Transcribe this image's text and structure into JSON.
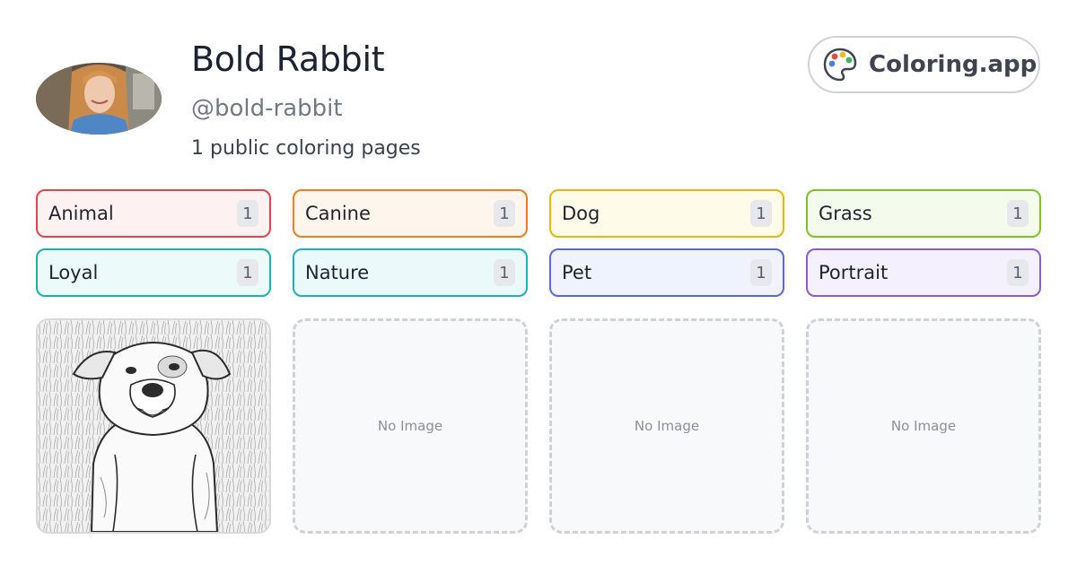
{
  "profile": {
    "name": "Bold Rabbit",
    "handle": "@bold-rabbit",
    "count_text": "1 public coloring pages"
  },
  "brand": {
    "label": "Coloring.app",
    "icon": "palette-icon"
  },
  "tags": [
    {
      "label": "Animal",
      "count": "1",
      "border": "#e0474c",
      "bg": "#fef1f1"
    },
    {
      "label": "Canine",
      "count": "1",
      "border": "#ef7d24",
      "bg": "#fef5ec"
    },
    {
      "label": "Dog",
      "count": "1",
      "border": "#e8b60c",
      "bg": "#fefbe8"
    },
    {
      "label": "Grass",
      "count": "1",
      "border": "#7ac623",
      "bg": "#f4fbec"
    },
    {
      "label": "Loyal",
      "count": "1",
      "border": "#19b3a8",
      "bg": "#ecfbf9"
    },
    {
      "label": "Nature",
      "count": "1",
      "border": "#19b0c8",
      "bg": "#ecf9fb"
    },
    {
      "label": "Pet",
      "count": "1",
      "border": "#5a68dd",
      "bg": "#f0f2fd"
    },
    {
      "label": "Portrait",
      "count": "1",
      "border": "#8b5bd8",
      "bg": "#f5f0fd"
    }
  ],
  "cards": [
    {
      "type": "image",
      "subject": "dog-coloring-page"
    },
    {
      "type": "empty",
      "label": "No Image"
    },
    {
      "type": "empty",
      "label": "No Image"
    },
    {
      "type": "empty",
      "label": "No Image"
    }
  ]
}
